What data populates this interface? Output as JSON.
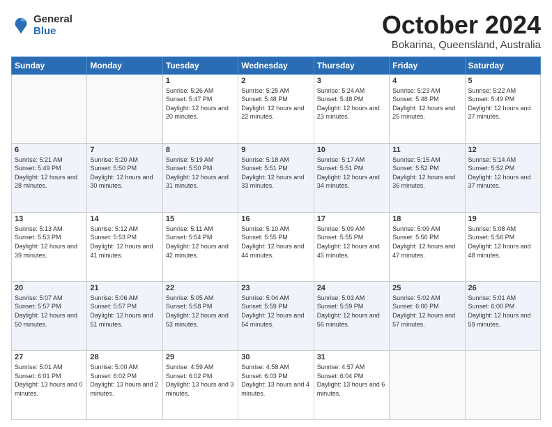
{
  "logo": {
    "general": "General",
    "blue": "Blue"
  },
  "title": "October 2024",
  "location": "Bokarina, Queensland, Australia",
  "days_header": [
    "Sunday",
    "Monday",
    "Tuesday",
    "Wednesday",
    "Thursday",
    "Friday",
    "Saturday"
  ],
  "weeks": [
    [
      {
        "num": "",
        "sunrise": "",
        "sunset": "",
        "daylight": ""
      },
      {
        "num": "",
        "sunrise": "",
        "sunset": "",
        "daylight": ""
      },
      {
        "num": "1",
        "sunrise": "Sunrise: 5:26 AM",
        "sunset": "Sunset: 5:47 PM",
        "daylight": "Daylight: 12 hours and 20 minutes."
      },
      {
        "num": "2",
        "sunrise": "Sunrise: 5:25 AM",
        "sunset": "Sunset: 5:48 PM",
        "daylight": "Daylight: 12 hours and 22 minutes."
      },
      {
        "num": "3",
        "sunrise": "Sunrise: 5:24 AM",
        "sunset": "Sunset: 5:48 PM",
        "daylight": "Daylight: 12 hours and 23 minutes."
      },
      {
        "num": "4",
        "sunrise": "Sunrise: 5:23 AM",
        "sunset": "Sunset: 5:48 PM",
        "daylight": "Daylight: 12 hours and 25 minutes."
      },
      {
        "num": "5",
        "sunrise": "Sunrise: 5:22 AM",
        "sunset": "Sunset: 5:49 PM",
        "daylight": "Daylight: 12 hours and 27 minutes."
      }
    ],
    [
      {
        "num": "6",
        "sunrise": "Sunrise: 5:21 AM",
        "sunset": "Sunset: 5:49 PM",
        "daylight": "Daylight: 12 hours and 28 minutes."
      },
      {
        "num": "7",
        "sunrise": "Sunrise: 5:20 AM",
        "sunset": "Sunset: 5:50 PM",
        "daylight": "Daylight: 12 hours and 30 minutes."
      },
      {
        "num": "8",
        "sunrise": "Sunrise: 5:19 AM",
        "sunset": "Sunset: 5:50 PM",
        "daylight": "Daylight: 12 hours and 31 minutes."
      },
      {
        "num": "9",
        "sunrise": "Sunrise: 5:18 AM",
        "sunset": "Sunset: 5:51 PM",
        "daylight": "Daylight: 12 hours and 33 minutes."
      },
      {
        "num": "10",
        "sunrise": "Sunrise: 5:17 AM",
        "sunset": "Sunset: 5:51 PM",
        "daylight": "Daylight: 12 hours and 34 minutes."
      },
      {
        "num": "11",
        "sunrise": "Sunrise: 5:15 AM",
        "sunset": "Sunset: 5:52 PM",
        "daylight": "Daylight: 12 hours and 36 minutes."
      },
      {
        "num": "12",
        "sunrise": "Sunrise: 5:14 AM",
        "sunset": "Sunset: 5:52 PM",
        "daylight": "Daylight: 12 hours and 37 minutes."
      }
    ],
    [
      {
        "num": "13",
        "sunrise": "Sunrise: 5:13 AM",
        "sunset": "Sunset: 5:53 PM",
        "daylight": "Daylight: 12 hours and 39 minutes."
      },
      {
        "num": "14",
        "sunrise": "Sunrise: 5:12 AM",
        "sunset": "Sunset: 5:53 PM",
        "daylight": "Daylight: 12 hours and 41 minutes."
      },
      {
        "num": "15",
        "sunrise": "Sunrise: 5:11 AM",
        "sunset": "Sunset: 5:54 PM",
        "daylight": "Daylight: 12 hours and 42 minutes."
      },
      {
        "num": "16",
        "sunrise": "Sunrise: 5:10 AM",
        "sunset": "Sunset: 5:55 PM",
        "daylight": "Daylight: 12 hours and 44 minutes."
      },
      {
        "num": "17",
        "sunrise": "Sunrise: 5:09 AM",
        "sunset": "Sunset: 5:55 PM",
        "daylight": "Daylight: 12 hours and 45 minutes."
      },
      {
        "num": "18",
        "sunrise": "Sunrise: 5:09 AM",
        "sunset": "Sunset: 5:56 PM",
        "daylight": "Daylight: 12 hours and 47 minutes."
      },
      {
        "num": "19",
        "sunrise": "Sunrise: 5:08 AM",
        "sunset": "Sunset: 5:56 PM",
        "daylight": "Daylight: 12 hours and 48 minutes."
      }
    ],
    [
      {
        "num": "20",
        "sunrise": "Sunrise: 5:07 AM",
        "sunset": "Sunset: 5:57 PM",
        "daylight": "Daylight: 12 hours and 50 minutes."
      },
      {
        "num": "21",
        "sunrise": "Sunrise: 5:06 AM",
        "sunset": "Sunset: 5:57 PM",
        "daylight": "Daylight: 12 hours and 51 minutes."
      },
      {
        "num": "22",
        "sunrise": "Sunrise: 5:05 AM",
        "sunset": "Sunset: 5:58 PM",
        "daylight": "Daylight: 12 hours and 53 minutes."
      },
      {
        "num": "23",
        "sunrise": "Sunrise: 5:04 AM",
        "sunset": "Sunset: 5:59 PM",
        "daylight": "Daylight: 12 hours and 54 minutes."
      },
      {
        "num": "24",
        "sunrise": "Sunrise: 5:03 AM",
        "sunset": "Sunset: 5:59 PM",
        "daylight": "Daylight: 12 hours and 56 minutes."
      },
      {
        "num": "25",
        "sunrise": "Sunrise: 5:02 AM",
        "sunset": "Sunset: 6:00 PM",
        "daylight": "Daylight: 12 hours and 57 minutes."
      },
      {
        "num": "26",
        "sunrise": "Sunrise: 5:01 AM",
        "sunset": "Sunset: 6:00 PM",
        "daylight": "Daylight: 12 hours and 59 minutes."
      }
    ],
    [
      {
        "num": "27",
        "sunrise": "Sunrise: 5:01 AM",
        "sunset": "Sunset: 6:01 PM",
        "daylight": "Daylight: 13 hours and 0 minutes."
      },
      {
        "num": "28",
        "sunrise": "Sunrise: 5:00 AM",
        "sunset": "Sunset: 6:02 PM",
        "daylight": "Daylight: 13 hours and 2 minutes."
      },
      {
        "num": "29",
        "sunrise": "Sunrise: 4:59 AM",
        "sunset": "Sunset: 6:02 PM",
        "daylight": "Daylight: 13 hours and 3 minutes."
      },
      {
        "num": "30",
        "sunrise": "Sunrise: 4:58 AM",
        "sunset": "Sunset: 6:03 PM",
        "daylight": "Daylight: 13 hours and 4 minutes."
      },
      {
        "num": "31",
        "sunrise": "Sunrise: 4:57 AM",
        "sunset": "Sunset: 6:04 PM",
        "daylight": "Daylight: 13 hours and 6 minutes."
      },
      {
        "num": "",
        "sunrise": "",
        "sunset": "",
        "daylight": ""
      },
      {
        "num": "",
        "sunrise": "",
        "sunset": "",
        "daylight": ""
      }
    ]
  ]
}
